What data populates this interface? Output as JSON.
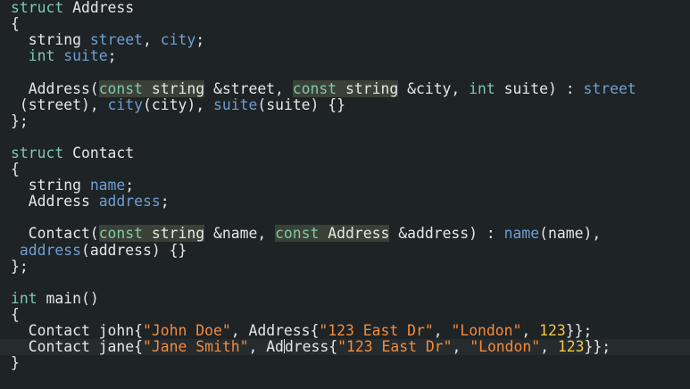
{
  "editor": {
    "lines": [
      {
        "tokens": [
          {
            "t": "struct",
            "c": "kw"
          },
          {
            "t": " Address",
            "c": "type"
          }
        ]
      },
      {
        "tokens": [
          {
            "t": "{",
            "c": "type"
          }
        ]
      },
      {
        "tokens": [
          {
            "t": "  string ",
            "c": "type"
          },
          {
            "t": "street",
            "c": "var"
          },
          {
            "t": ", ",
            "c": "type"
          },
          {
            "t": "city",
            "c": "var"
          },
          {
            "t": ";",
            "c": "type"
          }
        ]
      },
      {
        "tokens": [
          {
            "t": "  ",
            "c": "type"
          },
          {
            "t": "int",
            "c": "kw"
          },
          {
            "t": " ",
            "c": "type"
          },
          {
            "t": "suite",
            "c": "var"
          },
          {
            "t": ";",
            "c": "type"
          }
        ]
      },
      {
        "tokens": []
      },
      {
        "tokens": [
          {
            "t": "  Address(",
            "c": "type"
          },
          {
            "t": "const",
            "c": "kw hl"
          },
          {
            "t": " string",
            "c": "type hl"
          },
          {
            "t": " &street, ",
            "c": "type"
          },
          {
            "t": "const",
            "c": "kw hl"
          },
          {
            "t": " string",
            "c": "type hl"
          },
          {
            "t": " &city, ",
            "c": "type"
          },
          {
            "t": "int",
            "c": "kw"
          },
          {
            "t": " suite) : ",
            "c": "type"
          },
          {
            "t": "street",
            "c": "var"
          }
        ]
      },
      {
        "tokens": [
          {
            "t": " (street), ",
            "c": "type"
          },
          {
            "t": "city",
            "c": "var"
          },
          {
            "t": "(city), ",
            "c": "type"
          },
          {
            "t": "suite",
            "c": "var"
          },
          {
            "t": "(suite) {}",
            "c": "type"
          }
        ]
      },
      {
        "tokens": [
          {
            "t": "};",
            "c": "type"
          }
        ]
      },
      {
        "tokens": []
      },
      {
        "tokens": [
          {
            "t": "struct",
            "c": "kw"
          },
          {
            "t": " Contact",
            "c": "type"
          }
        ]
      },
      {
        "tokens": [
          {
            "t": "{",
            "c": "type"
          }
        ]
      },
      {
        "tokens": [
          {
            "t": "  string ",
            "c": "type"
          },
          {
            "t": "name",
            "c": "var"
          },
          {
            "t": ";",
            "c": "type"
          }
        ]
      },
      {
        "tokens": [
          {
            "t": "  Address ",
            "c": "type"
          },
          {
            "t": "address",
            "c": "var"
          },
          {
            "t": ";",
            "c": "type"
          }
        ]
      },
      {
        "tokens": []
      },
      {
        "tokens": [
          {
            "t": "  Contact(",
            "c": "type"
          },
          {
            "t": "const",
            "c": "kw hl"
          },
          {
            "t": " string",
            "c": "type hl"
          },
          {
            "t": " &name, ",
            "c": "type"
          },
          {
            "t": "const",
            "c": "kw hl"
          },
          {
            "t": " Address",
            "c": "type hl"
          },
          {
            "t": " &address) : ",
            "c": "type"
          },
          {
            "t": "name",
            "c": "var"
          },
          {
            "t": "(name),",
            "c": "type"
          }
        ]
      },
      {
        "tokens": [
          {
            "t": " ",
            "c": "type"
          },
          {
            "t": "address",
            "c": "var"
          },
          {
            "t": "(address) {}",
            "c": "type"
          }
        ]
      },
      {
        "tokens": [
          {
            "t": "};",
            "c": "type"
          }
        ]
      },
      {
        "tokens": []
      },
      {
        "tokens": [
          {
            "t": "int",
            "c": "kw"
          },
          {
            "t": " main()",
            "c": "type"
          }
        ]
      },
      {
        "tokens": [
          {
            "t": "{",
            "c": "type"
          }
        ]
      },
      {
        "tokens": [
          {
            "t": "  Contact john{",
            "c": "type"
          },
          {
            "t": "\"John Doe\"",
            "c": "str"
          },
          {
            "t": ", Address{",
            "c": "type"
          },
          {
            "t": "\"123 East Dr\"",
            "c": "str"
          },
          {
            "t": ", ",
            "c": "type"
          },
          {
            "t": "\"London\"",
            "c": "str"
          },
          {
            "t": ", ",
            "c": "type"
          },
          {
            "t": "123",
            "c": "num"
          },
          {
            "t": "}};",
            "c": "type"
          }
        ]
      },
      {
        "tokens": [
          {
            "t": "  Contact jane{",
            "c": "type"
          },
          {
            "t": "\"Jane Smith\"",
            "c": "str"
          },
          {
            "t": ", Ad",
            "c": "type"
          },
          {
            "t": "",
            "c": "caret"
          },
          {
            "t": "dress{",
            "c": "type"
          },
          {
            "t": "\"123 East Dr\"",
            "c": "str"
          },
          {
            "t": ", ",
            "c": "type"
          },
          {
            "t": "\"London\"",
            "c": "str"
          },
          {
            "t": ", ",
            "c": "type"
          },
          {
            "t": "123",
            "c": "num"
          },
          {
            "t": "}};",
            "c": "type"
          }
        ],
        "active": true
      },
      {
        "tokens": [
          {
            "t": "}",
            "c": "type"
          }
        ]
      }
    ]
  }
}
